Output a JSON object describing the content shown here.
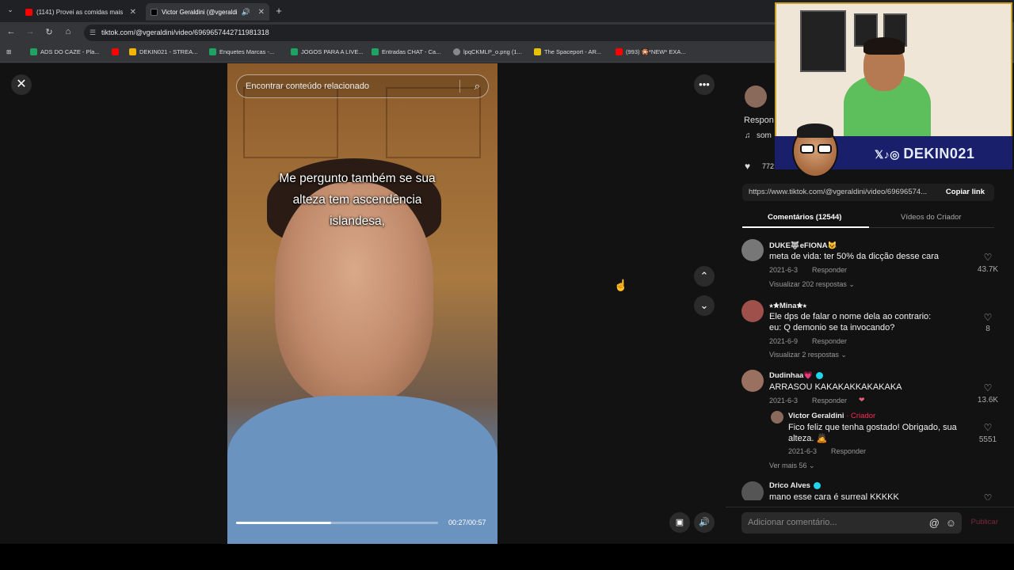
{
  "browser": {
    "tabs": [
      {
        "title": "(1141) Provei as comidas mais",
        "color": "#ff0000"
      },
      {
        "title": "Victor Geraldini (@vgeraldi",
        "color": "#111111"
      }
    ],
    "url": "tiktok.com/@vgeraldini/video/6969657442711981318",
    "bookmarks": [
      {
        "label": "ADS DO CAZE - Pla...",
        "color": "#1ea362"
      },
      {
        "label": "",
        "color": "#ff0000"
      },
      {
        "label": "DEKIN021 - STREA...",
        "color": "#f4b400"
      },
      {
        "label": "Enquetes Marcas -...",
        "color": "#1ea362"
      },
      {
        "label": "JOGOS PARA A LIVE...",
        "color": "#1ea362"
      },
      {
        "label": "Entradas CHAT - Ca...",
        "color": "#1ea362"
      },
      {
        "label": "lpqCKMLP_o.png (1...",
        "color": "#888888"
      },
      {
        "label": "The Spaceport - AR...",
        "color": "#e8c200"
      },
      {
        "label": "(993) 🎇*NEW* EXA...",
        "color": "#ff0000"
      }
    ]
  },
  "video": {
    "search_placeholder": "Encontrar conteúdo relacionado",
    "caption_lines": [
      "Me pergunto também se sua",
      "alteza tem ascendência",
      "islandesa,"
    ],
    "time": "00:27/00:57",
    "progress": 0.47
  },
  "panel": {
    "partial_reply": "Respon",
    "partial_sound": "som",
    "partial_likes": "772",
    "link": "https://www.tiktok.com/@vgeraldini/video/69696574...",
    "copy_label": "Copiar link",
    "tab_comments": "Comentários (12544)",
    "tab_creator": "Vídeos do Criador"
  },
  "overlay": {
    "brand": "DEKIN021"
  },
  "comments": [
    {
      "name": "DUKE🐺eFIONA😺",
      "text": "meta de vida: ter 50% da dicção desse cara",
      "date": "2021-6-3",
      "reply": "Responder",
      "likes": "43.7K",
      "more": "Visualizar 202 respostas",
      "avatar": "#777777"
    },
    {
      "name": "⭑✮Mina✮⭑",
      "text": "Ele dps de falar o nome dela ao contrario:\neu: Q demonio se ta invocando?",
      "date": "2021-6-9",
      "reply": "Responder",
      "likes": "8",
      "more": "Visualizar 2 respostas",
      "avatar": "#a0504a"
    },
    {
      "name": "Dudinhaa💗",
      "text": "ARRASOU KAKAKAKKAKAKAKA",
      "date": "2021-6-3",
      "reply": "Responder",
      "likes": "13.6K",
      "avatar": "#9a7060"
    },
    {
      "name": "Victor Geraldini",
      "creator_tag": "· Criador",
      "text": "Fico feliz que tenha gostado! Obrigado, sua alteza. 🙇",
      "date": "2021-6-3",
      "reply": "Responder",
      "likes": "5551",
      "more": "Ver mais 56",
      "avatar": "#8a6a5a"
    },
    {
      "name": "Drico Alves",
      "text": "mano esse cara é surreal KKKKK",
      "avatar": "#555555"
    }
  ],
  "comment_bar": {
    "placeholder": "Adicionar comentário...",
    "post": "Publicar"
  }
}
